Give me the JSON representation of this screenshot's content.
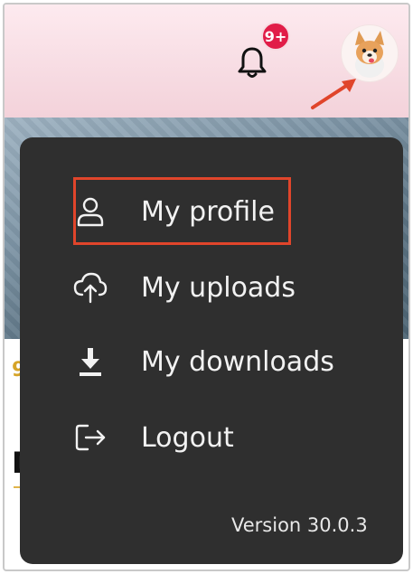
{
  "header": {
    "notification_count": "9+"
  },
  "menu": {
    "items": [
      {
        "label": "My profile",
        "icon": "user-icon"
      },
      {
        "label": "My uploads",
        "icon": "cloud-upload-icon"
      },
      {
        "label": "My downloads",
        "icon": "download-icon"
      },
      {
        "label": "Logout",
        "icon": "logout-icon"
      }
    ],
    "version": "Version 30.0.3"
  },
  "background": {
    "partial_text_1": "9",
    "partial_text_2": "D"
  },
  "colors": {
    "menu_bg": "#2f2f2f",
    "menu_text": "#f2f2f2",
    "badge": "#e11d48",
    "highlight": "#e0452b",
    "header_bg": "#f3d2da"
  }
}
